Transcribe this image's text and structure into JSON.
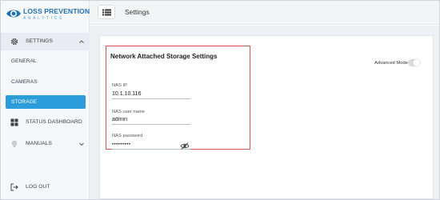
{
  "app": {
    "logo_title": "LOSS PREVENTION",
    "logo_subtitle": "ANALYTICS"
  },
  "sidebar": {
    "settings": {
      "label": "SETTINGS",
      "icon": "gear-icon",
      "expanded": true
    },
    "sub_items": [
      {
        "label": "GENERAL"
      },
      {
        "label": "CAMERAS"
      },
      {
        "label": "STORAGE",
        "active": true
      }
    ],
    "status_dashboard": {
      "label": "STATUS DASHBOARD",
      "icon": "dashboard-grid-icon"
    },
    "manuals": {
      "label": "MANUALS",
      "icon": "lightbulb-icon"
    },
    "logout": {
      "label": "LOG OUT",
      "icon": "logout-icon"
    }
  },
  "header": {
    "title": "Settings",
    "menu_icon": "list-menu-icon"
  },
  "card": {
    "title": "Network Attached Storage Settings",
    "advanced_mode_label": "Advanced Mode",
    "advanced_mode_on": false,
    "fields": {
      "nas_ip": {
        "label": "NAS IP",
        "value": "10.1.10.116"
      },
      "nas_user": {
        "label": "NAS user name",
        "value": "admin"
      },
      "nas_password": {
        "label": "NAS password",
        "value": "•••••••••",
        "icon": "eye-slash-icon"
      }
    }
  },
  "colors": {
    "brand": "#1f6fb2",
    "active_nav": "#2d9cdb",
    "highlight_border": "#d9534f"
  }
}
